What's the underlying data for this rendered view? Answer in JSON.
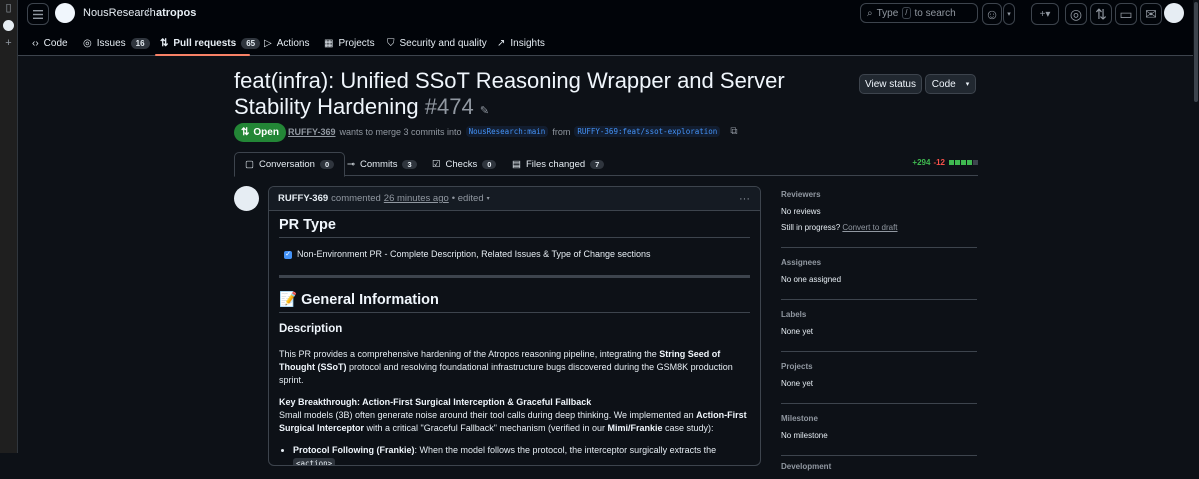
{
  "repo": {
    "owner": "NousResearch",
    "name": "atropos"
  },
  "search": {
    "prefix": "Type",
    "key": "/",
    "suffix": "to search"
  },
  "nav": [
    {
      "label": "Code",
      "count": null
    },
    {
      "label": "Issues",
      "count": "16"
    },
    {
      "label": "Pull requests",
      "count": "65"
    },
    {
      "label": "Actions",
      "count": null
    },
    {
      "label": "Projects",
      "count": null
    },
    {
      "label": "Security and quality",
      "count": null
    },
    {
      "label": "Insights",
      "count": null
    }
  ],
  "pr": {
    "title": "feat(infra): Unified SSoT Reasoning Wrapper and Server Stability Hardening",
    "number": "#474",
    "state": "Open",
    "author": "RUFFY-369",
    "merge_text": "wants to merge 3 commits into",
    "base": "NousResearch:main",
    "from": "from",
    "head": "RUFFY-369:feat/ssot-exploration",
    "view_status": "View status",
    "code_btn": "Code"
  },
  "pr_tabs": [
    {
      "label": "Conversation",
      "count": "0"
    },
    {
      "label": "Commits",
      "count": "3"
    },
    {
      "label": "Checks",
      "count": "0"
    },
    {
      "label": "Files changed",
      "count": "7"
    }
  ],
  "diffstat": {
    "additions": "+294",
    "deletions": "-12",
    "colors": [
      "#3fb950",
      "#3fb950",
      "#3fb950",
      "#3fb950",
      "#3d444d"
    ]
  },
  "comment": {
    "author": "RUFFY-369",
    "action": "commented",
    "time": "26 minutes ago",
    "edited": "• edited",
    "heading1": "PR Type",
    "checkbox": "Non-Environment PR - Complete Description, Related Issues & Type of Change sections",
    "heading2": "📝 General Information",
    "heading3": "Description",
    "p1_a": "This PR provides a comprehensive hardening of the Atropos reasoning pipeline, integrating the ",
    "p1_b": "String Seed of Thought (SSoT)",
    "p1_c": " protocol and resolving foundational infrastructure bugs discovered during the GSM8K production sprint.",
    "p2_title": "Key Breakthrough: Action-First Surgical Interception & Graceful Fallback",
    "p2_a": "Small models (3B) often generate noise around their tool calls during deep thinking. We implemented an ",
    "p2_b": "Action-First Surgical Interceptor",
    "p2_c": " with a critical \"Graceful Fallback\" mechanism (verified in our ",
    "p2_d": "Mimi/Frankie",
    "p2_e": " case study):",
    "li1_b": "Protocol Following (Frankie)",
    "li1_a": ": When the model follows the protocol, the interceptor surgically extracts the ",
    "li1_code": "<action>"
  },
  "sidebar": {
    "reviewers_h": "Reviewers",
    "reviewers_v": "No reviews",
    "progress_q": "Still in progress?",
    "draft_link": "Convert to draft",
    "assignees_h": "Assignees",
    "assignees_v": "No one assigned",
    "labels_h": "Labels",
    "labels_v": "None yet",
    "projects_h": "Projects",
    "projects_v": "None yet",
    "milestone_h": "Milestone",
    "milestone_v": "No milestone",
    "development_h": "Development"
  }
}
